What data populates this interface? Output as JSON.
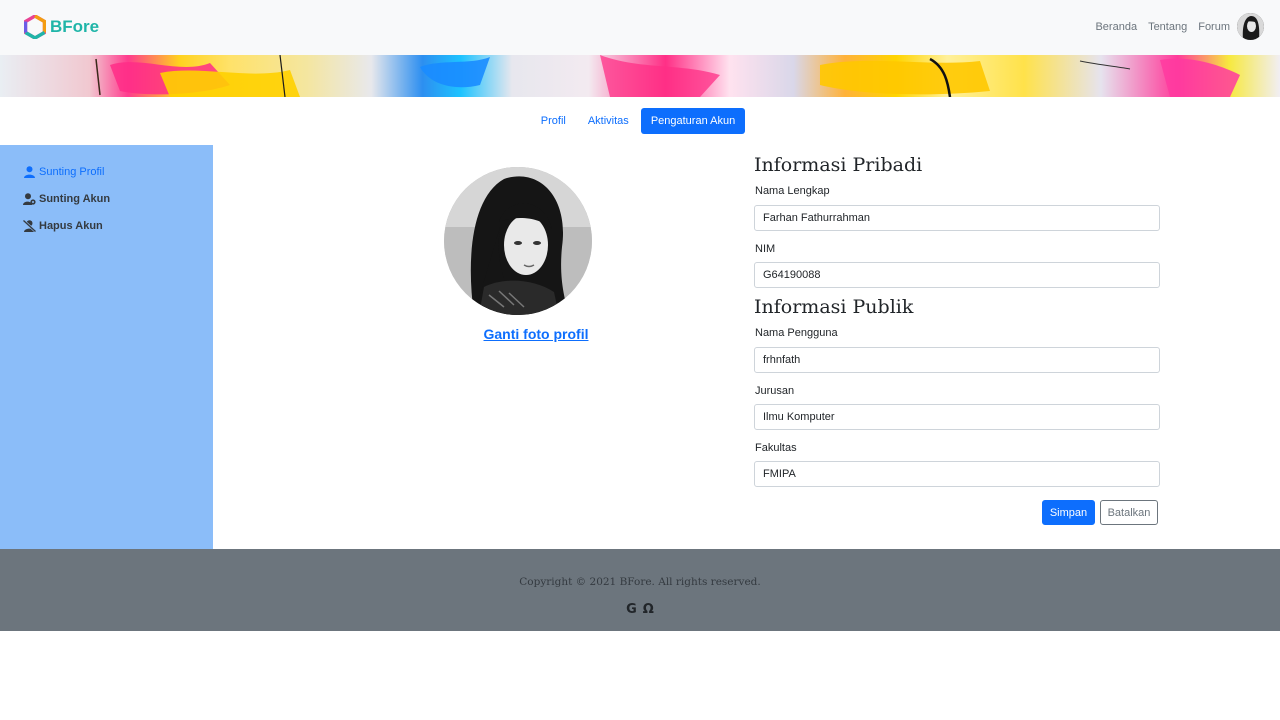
{
  "app": {
    "brand": "BFore"
  },
  "nav": {
    "links": [
      "Beranda",
      "Tentang",
      "Forum"
    ],
    "avatar_icon": "user-avatar"
  },
  "tabs": [
    {
      "label": "Profil",
      "active": false
    },
    {
      "label": "Aktivitas",
      "active": false
    },
    {
      "label": "Pengaturan Akun",
      "active": true
    }
  ],
  "sidebar": {
    "items": [
      {
        "label": "Sunting Profil",
        "icon": "user-icon",
        "active": true
      },
      {
        "label": "Sunting Akun",
        "icon": "user-cog-icon",
        "active": false
      },
      {
        "label": "Hapus Akun",
        "icon": "user-slash-icon",
        "active": false
      }
    ]
  },
  "profile": {
    "change_photo_label": "Ganti foto profil"
  },
  "form": {
    "private_title": "Informasi Pribadi",
    "public_title": "Informasi Publik",
    "fields": {
      "full_name": {
        "label": "Nama Lengkap",
        "value": "Farhan Fathurrahman"
      },
      "nim": {
        "label": "NIM",
        "value": "G64190088"
      },
      "username": {
        "label": "Nama Pengguna",
        "value": "frhnfath"
      },
      "major": {
        "label": "Jurusan",
        "value": "Ilmu Komputer"
      },
      "faculty": {
        "label": "Fakultas",
        "value": "FMIPA"
      }
    },
    "save_label": "Simpan",
    "cancel_label": "Batalkan"
  },
  "footer": {
    "copyright": "Copyright © 2021 BFore. All rights reserved.",
    "icons": [
      "google-icon",
      "omega-icon"
    ],
    "icon_glyphs": [
      "G",
      "Ω"
    ]
  },
  "colors": {
    "primary": "#0d6efd",
    "sidebar": "#8bbdf9",
    "footer": "#6c757d",
    "navbar": "#f8f9fa",
    "brand": "#1fb5a8"
  }
}
